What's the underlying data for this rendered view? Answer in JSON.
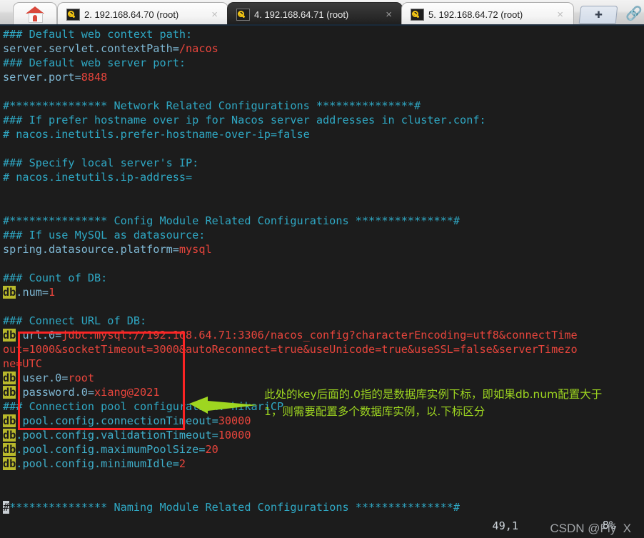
{
  "window": {
    "tabs": [
      {
        "icon": "home-icon",
        "label": "",
        "active": false,
        "closable": false
      },
      {
        "icon": "key-icon",
        "label": "2. 192.168.64.70 (root)",
        "close_label": "×",
        "active": false,
        "closable": true
      },
      {
        "icon": "key-icon",
        "label": "4. 192.168.64.71 (root)",
        "close_label": "×",
        "active": true,
        "closable": true
      },
      {
        "icon": "key-icon",
        "label": "5. 192.168.64.72 (root)",
        "close_label": "×",
        "active": false,
        "closable": true
      }
    ],
    "new_tab_label": "✚",
    "right_icon": "paperclip-icon"
  },
  "terminal": {
    "lines": [
      {
        "segs": [
          {
            "t": "### Default web context path:",
            "c": "c-comment"
          }
        ]
      },
      {
        "segs": [
          {
            "t": "server.servlet.contextPath=",
            "c": "c-key"
          },
          {
            "t": "/nacos",
            "c": "c-val"
          }
        ]
      },
      {
        "segs": [
          {
            "t": "### Default web server port:",
            "c": "c-comment"
          }
        ]
      },
      {
        "segs": [
          {
            "t": "server.port=",
            "c": "c-key"
          },
          {
            "t": "8848",
            "c": "c-val"
          }
        ]
      },
      {
        "segs": []
      },
      {
        "segs": [
          {
            "t": "#*************** Network Related Configurations ***************#",
            "c": "c-comment"
          }
        ]
      },
      {
        "segs": [
          {
            "t": "### If prefer hostname over ip for Nacos server addresses in cluster.conf:",
            "c": "c-comment"
          }
        ]
      },
      {
        "segs": [
          {
            "t": "# nacos.inetutils.prefer-hostname-over-ip=false",
            "c": "c-comment"
          }
        ]
      },
      {
        "segs": []
      },
      {
        "segs": [
          {
            "t": "### Specify local server's IP:",
            "c": "c-comment"
          }
        ]
      },
      {
        "segs": [
          {
            "t": "# nacos.inetutils.ip-address=",
            "c": "c-comment"
          }
        ]
      },
      {
        "segs": []
      },
      {
        "segs": []
      },
      {
        "segs": [
          {
            "t": "#*************** Config Module Related Configurations ***************#",
            "c": "c-comment"
          }
        ]
      },
      {
        "segs": [
          {
            "t": "### If use MySQL as datasource:",
            "c": "c-comment"
          }
        ]
      },
      {
        "segs": [
          {
            "t": "spring.datasource.platform=",
            "c": "c-key"
          },
          {
            "t": "mysql",
            "c": "c-val"
          }
        ]
      },
      {
        "segs": []
      },
      {
        "segs": [
          {
            "t": "### Count of DB:",
            "c": "c-comment"
          }
        ]
      },
      {
        "segs": [
          {
            "t": "db",
            "c": "hl-db"
          },
          {
            "t": ".num=",
            "c": "c-key"
          },
          {
            "t": "1",
            "c": "c-val"
          }
        ]
      },
      {
        "segs": []
      },
      {
        "segs": [
          {
            "t": "### Connect URL of DB:",
            "c": "c-comment"
          }
        ]
      },
      {
        "segs": [
          {
            "t": "db",
            "c": "hl-db"
          },
          {
            "t": ".url.0=",
            "c": "c-key"
          },
          {
            "t": "jdbc:mysql://192.168.64.71:3306/nacos_config?characterEncoding=utf8&connectTime",
            "c": "c-val"
          }
        ]
      },
      {
        "segs": [
          {
            "t": "out=1000&socketTimeout=3000&autoReconnect=true&useUnicode=true&useSSL=false&serverTimezo",
            "c": "c-val"
          }
        ]
      },
      {
        "segs": [
          {
            "t": "ne=UTC",
            "c": "c-val"
          }
        ]
      },
      {
        "segs": [
          {
            "t": "db",
            "c": "hl-db"
          },
          {
            "t": ".user.0=",
            "c": "c-key"
          },
          {
            "t": "root",
            "c": "c-val"
          }
        ]
      },
      {
        "segs": [
          {
            "t": "db",
            "c": "hl-db"
          },
          {
            "t": ".password.0=",
            "c": "c-key"
          },
          {
            "t": "xiang@2021",
            "c": "c-val"
          }
        ]
      },
      {
        "segs": [
          {
            "t": "### Connection pool configuration: hikariCP",
            "c": "c-comment"
          }
        ]
      },
      {
        "segs": [
          {
            "t": "db",
            "c": "hl-db"
          },
          {
            "t": ".pool.config.connectionTimeout=",
            "c": "c-key2"
          },
          {
            "t": "30000",
            "c": "c-val"
          }
        ]
      },
      {
        "segs": [
          {
            "t": "db",
            "c": "hl-db"
          },
          {
            "t": ".pool.config.validationTimeout=",
            "c": "c-key2"
          },
          {
            "t": "10000",
            "c": "c-val"
          }
        ]
      },
      {
        "segs": [
          {
            "t": "db",
            "c": "hl-db"
          },
          {
            "t": ".pool.config.maximumPoolSize=",
            "c": "c-key2"
          },
          {
            "t": "20",
            "c": "c-val"
          }
        ]
      },
      {
        "segs": [
          {
            "t": "db",
            "c": "hl-db"
          },
          {
            "t": ".pool.config.minimumIdle=",
            "c": "c-key2"
          },
          {
            "t": "2",
            "c": "c-val"
          }
        ]
      },
      {
        "segs": []
      },
      {
        "segs": []
      },
      {
        "segs": [
          {
            "t": "#",
            "c": "cursor-blk"
          },
          {
            "t": "*************** Naming Module Related Configurations ***************#",
            "c": "c-comment"
          }
        ]
      }
    ],
    "annotation": {
      "cn_text": "此处的key后面的.0指的是数据库实例下标，即如果db.num配置大于\n1，则需要配置多个数据库实例，以.下标区分",
      "arrow_color": "#9ed620",
      "box_color": "#fb2424"
    },
    "status": {
      "position": "49,1",
      "percent": "8%",
      "watermark": "CSDN @Fly  X"
    },
    "colors": {
      "background": "#1c1c1c",
      "comment": "#2fa8c4",
      "key": "#7fb8d4",
      "value": "#e8453c",
      "highlight_bg": "#b9b92b",
      "annotation_green": "#9ed620",
      "annotation_red": "#fb2424"
    }
  }
}
